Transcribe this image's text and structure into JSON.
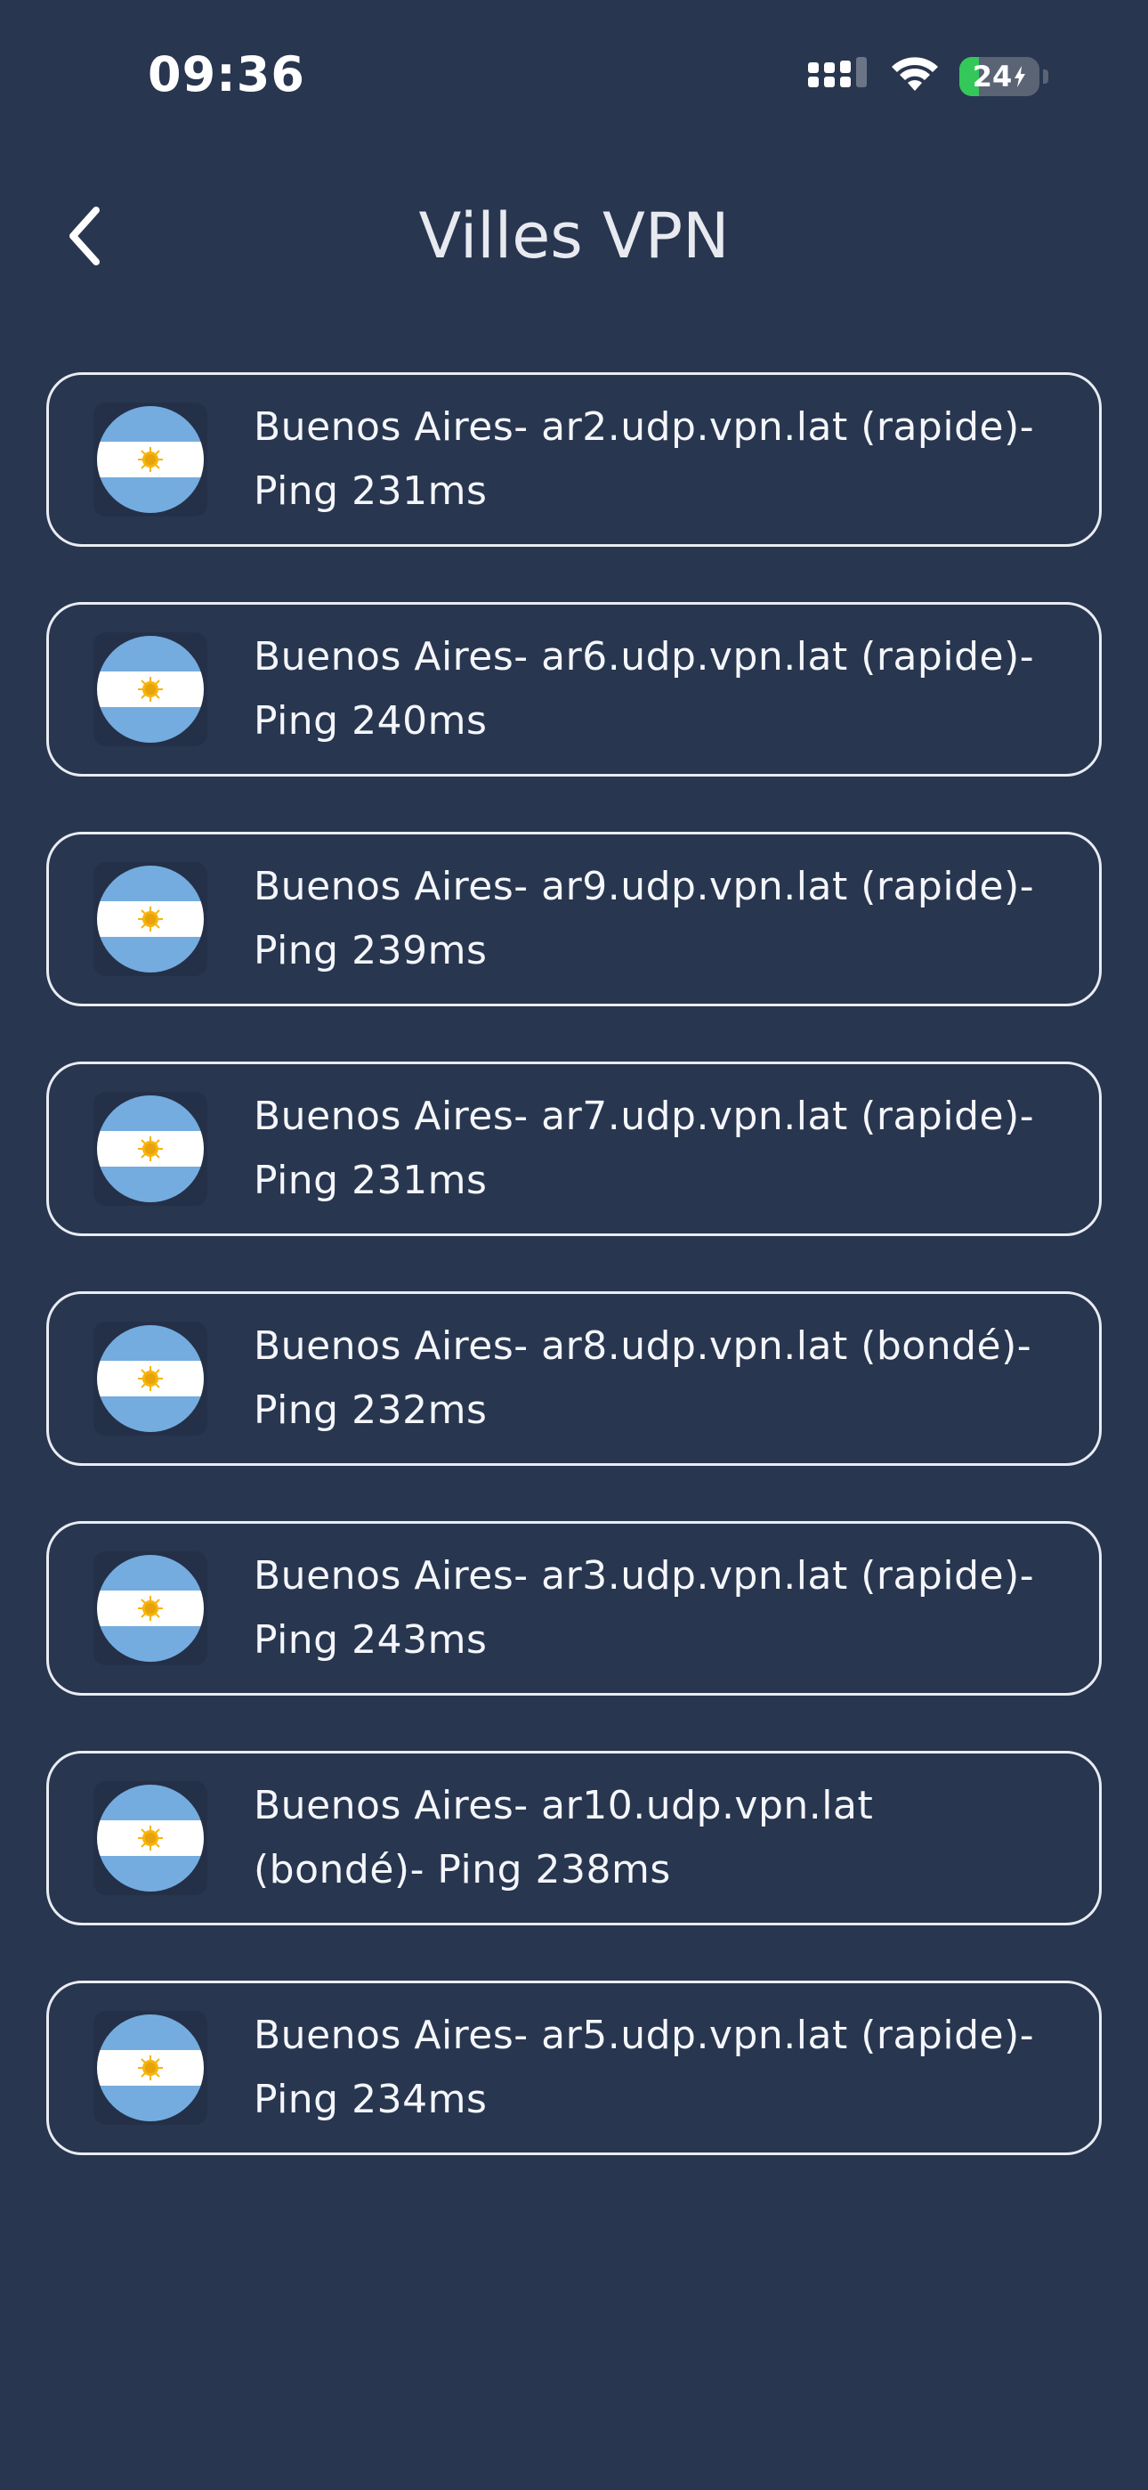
{
  "status_bar": {
    "time": "09:36",
    "battery_level": "24",
    "battery_fraction": 0.24,
    "icons": [
      "signal-icon",
      "wifi-icon",
      "battery-icon"
    ]
  },
  "header": {
    "title": "Villes VPN",
    "back_icon": "chevron-left-icon"
  },
  "colors": {
    "background": "#283650",
    "border": "#e9ecf2",
    "flag_blue": "#74acdf",
    "flag_white": "#ffffff",
    "sun": "#f6b40e",
    "battery_green": "#34c759"
  },
  "servers": [
    {
      "flag": "argentina-flag-icon",
      "line1": "Buenos Aires- ar2.udp.vpn.lat (rapide)-",
      "line2": "Ping 231ms"
    },
    {
      "flag": "argentina-flag-icon",
      "line1": "Buenos Aires- ar6.udp.vpn.lat (rapide)-",
      "line2": "Ping 240ms"
    },
    {
      "flag": "argentina-flag-icon",
      "line1": "Buenos Aires- ar9.udp.vpn.lat (rapide)-",
      "line2": "Ping 239ms"
    },
    {
      "flag": "argentina-flag-icon",
      "line1": "Buenos Aires- ar7.udp.vpn.lat (rapide)-",
      "line2": "Ping 231ms"
    },
    {
      "flag": "argentina-flag-icon",
      "line1": "Buenos Aires- ar8.udp.vpn.lat (bondé)-",
      "line2": "Ping 232ms"
    },
    {
      "flag": "argentina-flag-icon",
      "line1": "Buenos Aires- ar3.udp.vpn.lat (rapide)-",
      "line2": "Ping 243ms"
    },
    {
      "flag": "argentina-flag-icon",
      "line1": "Buenos Aires- ar10.udp.vpn.lat",
      "line2": "(bondé)- Ping 238ms"
    },
    {
      "flag": "argentina-flag-icon",
      "line1": "Buenos Aires- ar5.udp.vpn.lat (rapide)-",
      "line2": "Ping 234ms"
    }
  ]
}
